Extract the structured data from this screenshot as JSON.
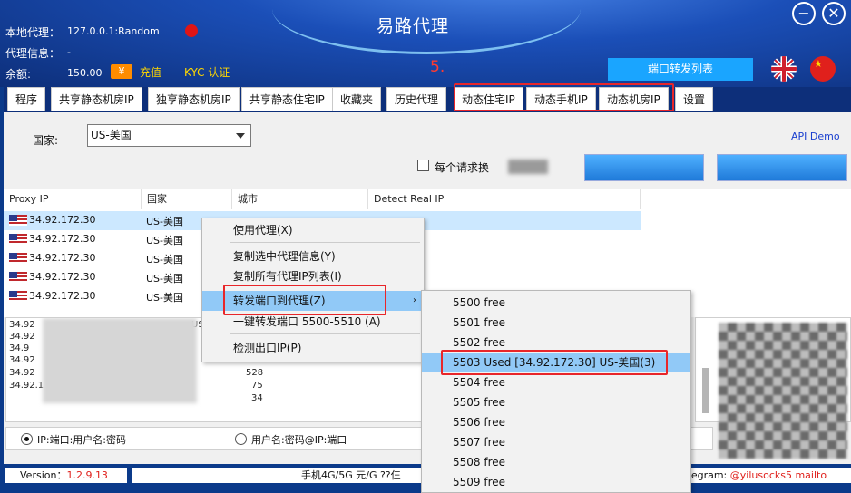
{
  "window": {
    "title": "易路代理",
    "minimize_glyph": "−",
    "close_glyph": "✕"
  },
  "header": {
    "local_proxy_label": "本地代理：",
    "local_proxy_value": "127.0.0.1:Random",
    "proxy_info_label": "代理信息：",
    "proxy_info_value": "-",
    "balance_label": "余额:",
    "balance_value": "150.00",
    "yen_icon": "¥",
    "recharge_label": "充值",
    "kyc_label": "KYC 认证",
    "step_annotation": "5.",
    "port_forward_list_label": "端口转发列表",
    "status_dot_color": "#e01515"
  },
  "tabs": [
    {
      "label": "程序"
    },
    {
      "label": "共享静态机房IP"
    },
    {
      "label": "独享静态机房IP"
    },
    {
      "label": "共享静态住宅IP"
    },
    {
      "label": "收藏夹"
    },
    {
      "label": "历史代理"
    },
    {
      "label": "动态住宅IP"
    },
    {
      "label": "动态手机IP"
    },
    {
      "label": "动态机房IP"
    },
    {
      "label": "设置"
    }
  ],
  "filters": {
    "country_label": "国家:",
    "country_value": "US-美国",
    "api_demo_label": "API Demo",
    "per_request_label": "每个请求换"
  },
  "table": {
    "headers": [
      "Proxy IP",
      "国家",
      "城市",
      "Detect Real IP"
    ],
    "rows": [
      {
        "ip": "34.92.172.30",
        "country": "US-美国"
      },
      {
        "ip": "34.92.172.30",
        "country": "US-美国"
      },
      {
        "ip": "34.92.172.30",
        "country": "US-美国"
      },
      {
        "ip": "34.92.172.30",
        "country": "US-美国"
      },
      {
        "ip": "34.92.172.30",
        "country": "US-美国"
      }
    ]
  },
  "log": {
    "lines": [
      "34.92",
      "34.92",
      "34.9",
      "34.92",
      "34.92",
      "34.92.1"
    ],
    "fragments": [
      "US-",
      "US-",
      "528",
      "75",
      "34"
    ]
  },
  "format_options": {
    "option1": "IP:端口:用户名:密码",
    "option2": "用户名:密码@IP:端口"
  },
  "footer": {
    "version_label": "Version：",
    "version_value": "1.2.9.13",
    "marquee_text": "手机4G/5G        元/G ??仨",
    "telegram_label": "elegram: ",
    "telegram_handle": "@yilusocks5",
    "mailto_label": "mailto"
  },
  "context_menu": {
    "items": [
      {
        "label": "使用代理(X)"
      },
      {
        "label": "复制选中代理信息(Y)"
      },
      {
        "label": "复制所有代理IP列表(I)"
      },
      {
        "label": "转发端口到代理(Z)",
        "arrow": "›"
      },
      {
        "label": "一键转发端口 5500-5510 (A)"
      },
      {
        "label": "检测出口IP(P)"
      }
    ]
  },
  "submenu": {
    "items": [
      {
        "label": "5500 free"
      },
      {
        "label": "5501 free"
      },
      {
        "label": "5502 free"
      },
      {
        "label": "5503 Used [34.92.172.30] US-美国(3)"
      },
      {
        "label": "5504 free"
      },
      {
        "label": "5505 free"
      },
      {
        "label": "5506 free"
      },
      {
        "label": "5507 free"
      },
      {
        "label": "5508 free"
      },
      {
        "label": "5509 free"
      }
    ]
  },
  "colors": {
    "header_bg": "#1b4fb8",
    "highlight_red": "#e8262a",
    "selection_blue": "#cce8ff",
    "menu_hover": "#91c9f7"
  }
}
